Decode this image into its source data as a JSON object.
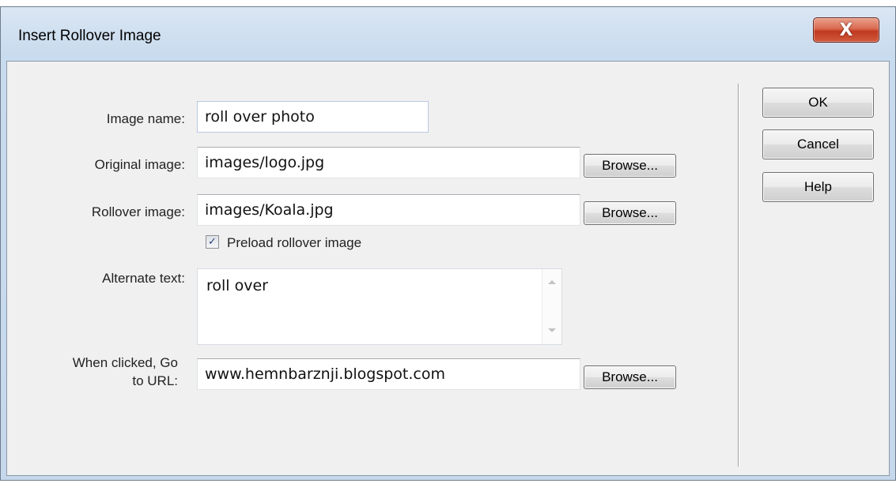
{
  "window": {
    "title": "Insert Rollover Image",
    "close_glyph": "X"
  },
  "form": {
    "image_name": {
      "label": "Image name:",
      "value": "roll over photo"
    },
    "original_image": {
      "label": "Original image:",
      "value": "images/logo.jpg",
      "browse_label": "Browse..."
    },
    "rollover_image": {
      "label": "Rollover image:",
      "value": "images/Koala.jpg",
      "browse_label": "Browse..."
    },
    "preload": {
      "label": "Preload rollover image",
      "checked": true,
      "check_glyph": "✓"
    },
    "alternate_text": {
      "label": "Alternate text:",
      "value": "roll over"
    },
    "go_to_url": {
      "label_line1": "When clicked, Go",
      "label_line2": "to URL:",
      "value": "www.hemnbarznji.blogspot.com",
      "browse_label": "Browse..."
    }
  },
  "buttons": {
    "ok": "OK",
    "cancel": "Cancel",
    "help": "Help"
  },
  "icons": {
    "close": "close-icon",
    "checkbox": "checkmark-icon",
    "scroll_up": "scroll-up-arrow-icon",
    "scroll_down": "scroll-down-arrow-icon"
  },
  "colors": {
    "client_background": "#f0f0f0",
    "title_gradient_top": "#dae6f3",
    "close_button": "#c0391f"
  }
}
